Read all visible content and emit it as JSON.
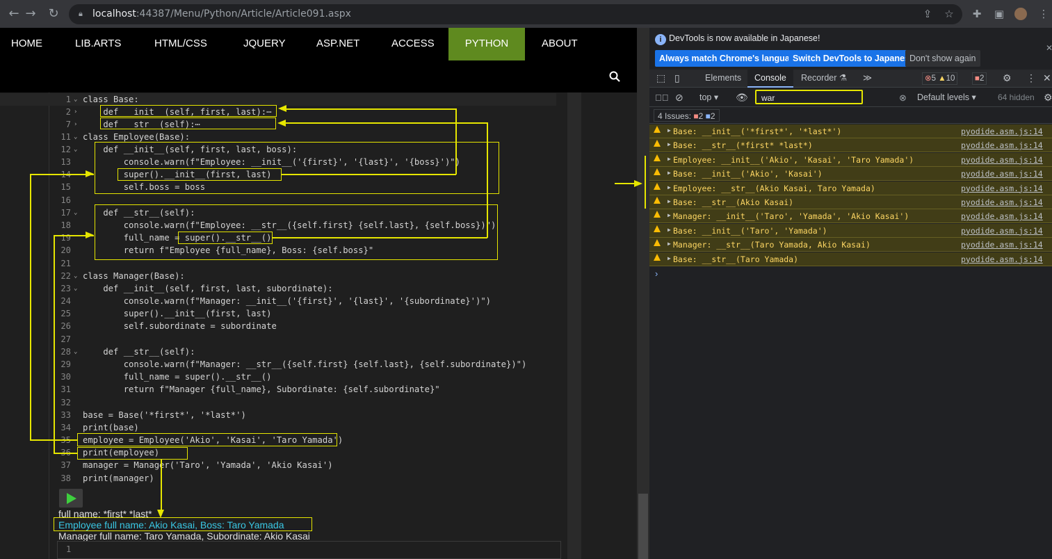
{
  "browser": {
    "url_host": "localhost",
    "url_rest": ":44387/Menu/Python/Article/Article091.aspx"
  },
  "site_nav": [
    "HOME",
    "LIB.ARTS",
    "HTML/CSS",
    "JQUERY",
    "ASP.NET",
    "ACCESS",
    "PYTHON",
    "ABOUT"
  ],
  "active_nav": "PYTHON",
  "colors": {
    "nav_active": "#5f8a1f",
    "annotation": "#e6e600",
    "warning_bg": "#413d17"
  },
  "code_lines": [
    {
      "num": "1",
      "fold": "⌄",
      "text": "class Base:"
    },
    {
      "num": "2",
      "fold": "›",
      "text": "    def __init__(self, first, last):⋯"
    },
    {
      "num": "7",
      "fold": "›",
      "text": "    def __str__(self):⋯"
    },
    {
      "num": "11",
      "fold": "⌄",
      "text": "class Employee(Base):"
    },
    {
      "num": "12",
      "fold": "⌄",
      "text": "    def __init__(self, first, last, boss):"
    },
    {
      "num": "13",
      "fold": "",
      "text": "        console.warn(f\"Employee: __init__('{first}', '{last}', '{boss}')\")"
    },
    {
      "num": "14",
      "fold": "",
      "text": "        super().__init__(first, last)"
    },
    {
      "num": "15",
      "fold": "",
      "text": "        self.boss = boss"
    },
    {
      "num": "16",
      "fold": "",
      "text": ""
    },
    {
      "num": "17",
      "fold": "⌄",
      "text": "    def __str__(self):"
    },
    {
      "num": "18",
      "fold": "",
      "text": "        console.warn(f\"Employee: __str__({self.first} {self.last}, {self.boss})\")"
    },
    {
      "num": "19",
      "fold": "",
      "text": "        full_name = super().__str__()"
    },
    {
      "num": "20",
      "fold": "",
      "text": "        return f\"Employee {full_name}, Boss: {self.boss}\""
    },
    {
      "num": "21",
      "fold": "",
      "text": ""
    },
    {
      "num": "22",
      "fold": "⌄",
      "text": "class Manager(Base):"
    },
    {
      "num": "23",
      "fold": "⌄",
      "text": "    def __init__(self, first, last, subordinate):"
    },
    {
      "num": "24",
      "fold": "",
      "text": "        console.warn(f\"Manager: __init__('{first}', '{last}', '{subordinate}')\")"
    },
    {
      "num": "25",
      "fold": "",
      "text": "        super().__init__(first, last)"
    },
    {
      "num": "26",
      "fold": "",
      "text": "        self.subordinate = subordinate"
    },
    {
      "num": "27",
      "fold": "",
      "text": ""
    },
    {
      "num": "28",
      "fold": "⌄",
      "text": "    def __str__(self):"
    },
    {
      "num": "29",
      "fold": "",
      "text": "        console.warn(f\"Manager: __str__({self.first} {self.last}, {self.subordinate})\")"
    },
    {
      "num": "30",
      "fold": "",
      "text": "        full_name = super().__str__()"
    },
    {
      "num": "31",
      "fold": "",
      "text": "        return f\"Manager {full_name}, Subordinate: {self.subordinate}\""
    },
    {
      "num": "32",
      "fold": "",
      "text": ""
    },
    {
      "num": "33",
      "fold": "",
      "text": "base = Base('*first*', '*last*')"
    },
    {
      "num": "34",
      "fold": "",
      "text": "print(base)"
    },
    {
      "num": "35",
      "fold": "",
      "text": "employee = Employee('Akio', 'Kasai', 'Taro Yamada')"
    },
    {
      "num": "36",
      "fold": "",
      "text": "print(employee)"
    },
    {
      "num": "37",
      "fold": "",
      "text": "manager = Manager('Taro', 'Yamada', 'Akio Kasai')"
    },
    {
      "num": "38",
      "fold": "",
      "text": "print(manager)"
    }
  ],
  "output": {
    "line1": "full name: *first* *last*",
    "line2": "Employee full name: Akio Kasai, Boss: Taro Yamada",
    "line3": "Manager full name: Taro Yamada, Subordinate: Akio Kasai"
  },
  "second_editor_line": "1",
  "devtools": {
    "info": "DevTools is now available in Japanese!",
    "btn_match": "Always match Chrome's language",
    "btn_switch": "Switch DevTools to Japanese",
    "btn_dont": "Don't show again",
    "tabs": [
      "Elements",
      "Console",
      "Recorder ⚗"
    ],
    "active_tab": "Console",
    "err_count": "5",
    "warn_count": "10",
    "issue_count": "2",
    "context": "top",
    "filter": "war",
    "levels": "Default levels",
    "hidden": "64 hidden",
    "issues_label": "4 Issues:",
    "issues_err": "2",
    "issues_info": "2",
    "messages": [
      {
        "text": "Base: __init__('*first*', '*last*')",
        "src": "pyodide.asm.js:14"
      },
      {
        "text": "Base: __str__(*first* *last*)",
        "src": "pyodide.asm.js:14"
      },
      {
        "text": "Employee: __init__('Akio', 'Kasai', 'Taro Yamada')",
        "src": "pyodide.asm.js:14"
      },
      {
        "text": "Base: __init__('Akio', 'Kasai')",
        "src": "pyodide.asm.js:14"
      },
      {
        "text": "Employee: __str__(Akio Kasai, Taro Yamada)",
        "src": "pyodide.asm.js:14"
      },
      {
        "text": "Base: __str__(Akio Kasai)",
        "src": "pyodide.asm.js:14"
      },
      {
        "text": "Manager: __init__('Taro', 'Yamada', 'Akio Kasai')",
        "src": "pyodide.asm.js:14"
      },
      {
        "text": "Base: __init__('Taro', 'Yamada')",
        "src": "pyodide.asm.js:14"
      },
      {
        "text": "Manager: __str__(Taro Yamada, Akio Kasai)",
        "src": "pyodide.asm.js:14"
      },
      {
        "text": "Base: __str__(Taro Yamada)",
        "src": "pyodide.asm.js:14"
      }
    ]
  }
}
